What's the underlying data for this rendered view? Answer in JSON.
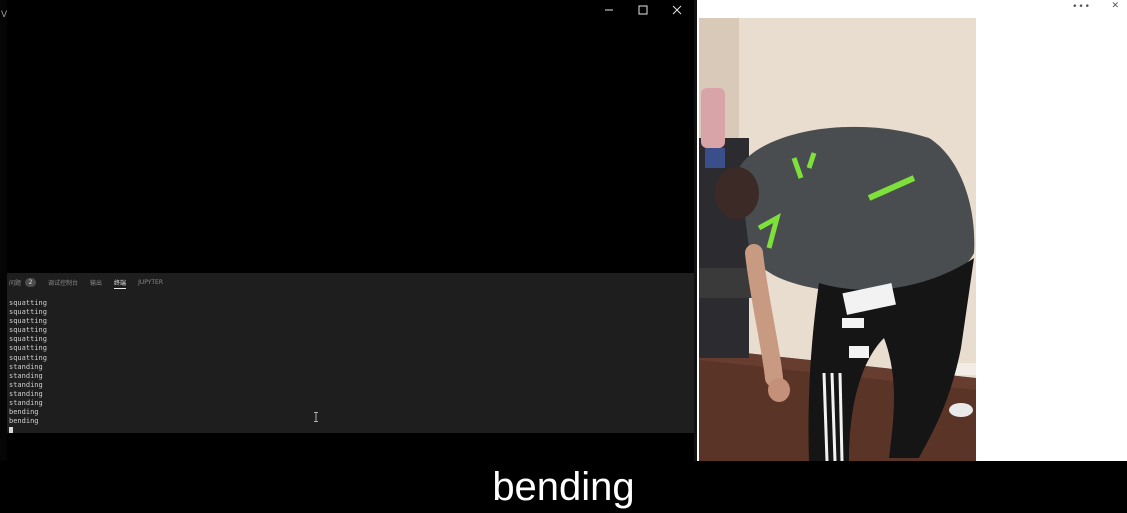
{
  "left_window": {
    "title_glyph": "V",
    "controls": {
      "minimize": "minimize-icon",
      "maximize": "maximize-icon",
      "close": "close-icon"
    },
    "panel": {
      "tabs": [
        {
          "label": "问题",
          "badge": "2",
          "active": false
        },
        {
          "label": "调试控制台",
          "active": false
        },
        {
          "label": "输出",
          "active": false
        },
        {
          "label": "终端",
          "active": true
        },
        {
          "label": "JUPYTER",
          "active": false
        }
      ],
      "terminal_lines": [
        "squatting",
        "squatting",
        "squatting",
        "squatting",
        "squatting",
        "squatting",
        "squatting",
        "standing",
        "standing",
        "standing",
        "standing",
        "standing",
        "bending",
        "bending"
      ]
    }
  },
  "right_window": {
    "icons": [
      "more-icon",
      "close-icon"
    ],
    "more_glyph": "•••",
    "close_glyph": "✕"
  },
  "caption": {
    "text": "bending"
  },
  "colors": {
    "panel_bg": "#1e1e1e",
    "terminal_text": "#cfcfcf",
    "caption_text": "#ffffff"
  }
}
